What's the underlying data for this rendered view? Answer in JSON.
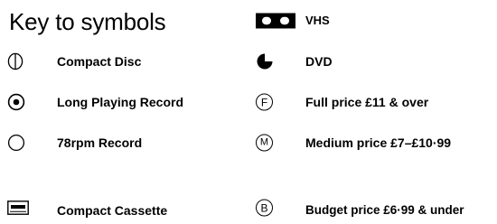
{
  "title": "Key to symbols",
  "left_items": [
    {
      "icon": "compact-disc-icon",
      "label": "Compact Disc"
    },
    {
      "icon": "long-playing-record-icon",
      "label": "Long Playing Record"
    },
    {
      "icon": "78rpm-record-icon",
      "label": "78rpm Record"
    },
    {
      "icon": "compact-cassette-icon",
      "label": "Compact Cassette"
    }
  ],
  "right_items": [
    {
      "icon": "vhs-icon",
      "label": "VHS"
    },
    {
      "icon": "dvd-icon",
      "label": "DVD"
    },
    {
      "icon": "full-price-icon",
      "letter": "F",
      "label": "Full price £11 & over"
    },
    {
      "icon": "medium-price-icon",
      "letter": "M",
      "label": "Medium price £7–£10·99"
    },
    {
      "icon": "budget-price-icon",
      "letter": "B",
      "label": "Budget price £6·99 & under"
    }
  ]
}
